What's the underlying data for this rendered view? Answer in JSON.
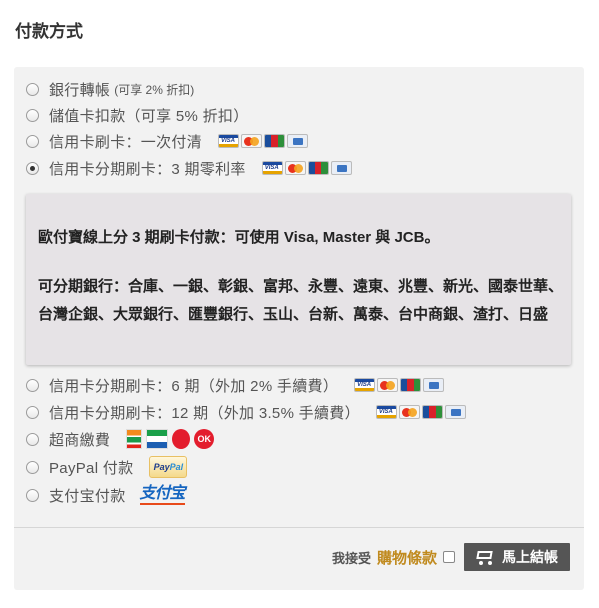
{
  "heading": "付款方式",
  "options": [
    {
      "label": "銀行轉帳",
      "note": "(可享 2% 折扣)",
      "checked": false,
      "icons": []
    },
    {
      "label": "儲值卡扣款（可享 5% 折扣）",
      "checked": false,
      "icons": []
    },
    {
      "label": "信用卡刷卡：一次付清",
      "checked": false,
      "icons": [
        "visa-icon",
        "mastercard-icon",
        "jcb-icon",
        "card-icon"
      ]
    },
    {
      "label": "信用卡分期刷卡：3 期零利率",
      "checked": true,
      "icons": [
        "visa-icon",
        "mastercard-icon",
        "jcb-icon",
        "card-icon"
      ]
    },
    {
      "label": "信用卡分期刷卡：6 期（外加 2% 手續費）",
      "checked": false,
      "icons": [
        "visa-icon",
        "mastercard-icon",
        "jcb-icon",
        "card-icon"
      ]
    },
    {
      "label": "信用卡分期刷卡：12 期（外加 3.5% 手續費）",
      "checked": false,
      "icons": [
        "visa-icon",
        "mastercard-icon",
        "jcb-icon",
        "card-icon"
      ]
    },
    {
      "label": "超商繳費",
      "checked": false,
      "icons": [
        "7-eleven-icon",
        "familymart-icon",
        "hilife-icon",
        "ok-mart-icon"
      ]
    },
    {
      "label": "PayPal 付款",
      "checked": false,
      "icons": [
        "paypal-icon"
      ]
    },
    {
      "label": "支付宝付款",
      "checked": false,
      "icons": [
        "alipay-icon"
      ]
    }
  ],
  "info": {
    "line1": "歐付寶線上分 3 期刷卡付款：可使用 Visa, Master 與 JCB。",
    "line2": "可分期銀行：合庫、一銀、彰銀、富邦、永豐、遠東、兆豐、新光、國泰世華、台灣企銀、大眾銀行、匯豐銀行、玉山、台新、萬泰、台中商銀、渣打、日盛"
  },
  "logos": {
    "visa": "VISA",
    "ok": "OK",
    "paypal_a": "Pay",
    "paypal_b": "Pal",
    "alipay": "支付宝"
  },
  "footer": {
    "agree": "我接受",
    "terms": "購物條款",
    "checkout": "馬上結帳"
  },
  "colors": {
    "panel_bg": "#f2f2f2",
    "info_bg": "#e6e3e6",
    "terms_link": "#c08a1e",
    "checkout_bg": "#555555"
  }
}
